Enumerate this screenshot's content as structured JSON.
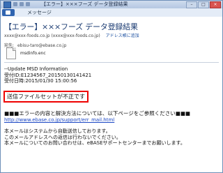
{
  "window": {
    "title": "【エラー】×××フーズ データ登録結果",
    "buttons": {
      "minimize": "–",
      "maximize": "□",
      "close": "×"
    }
  },
  "ribbon": {
    "tab_message": "メッセージ"
  },
  "email": {
    "subject": "【エラー】×××フーズ データ登録結果",
    "from": "xxxx@xxx-foods.co.jp (xxxx@xxx-foods.co.jp)",
    "add_to_address_book": "アドレス帳に追加",
    "to_label": "宛先:",
    "to": "ebisu-taro@ebase.co.jp",
    "attachment": "msdinfo.enc",
    "body_lines": [
      "--Update MSD Information",
      "受付ID:E1234567_20150130141421",
      "受付日時:2015/01/30 15:00:56"
    ],
    "error_message": "送信ファイルセットが不正です",
    "notice": "■■■エラーの内容と解決方法については、以下ページをご参照ください■■■",
    "url": "http://www.ebase.co.jp/support/err_mail.html",
    "auto_lines": [
      "本メールはシステムから自動送信しております。",
      "このメールアドレスへの返信は行わないでください。",
      "本メールについてのお問い合わせは、eBASEサポートセンターまでお願いします。"
    ]
  }
}
